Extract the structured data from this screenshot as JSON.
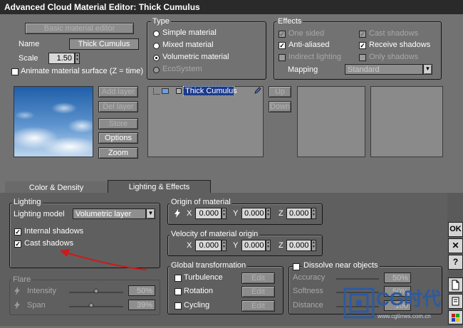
{
  "window": {
    "title": "Advanced Cloud Material Editor: Thick Cumulus"
  },
  "material": {
    "basic_editor_label": "Basic material editor",
    "name_label": "Name",
    "name_value": "Thick Cumulus",
    "scale_label": "Scale",
    "scale_value": "1.50",
    "animate_label": "Animate material surface (Z = time)",
    "animate_checked": false
  },
  "type_group": {
    "title": "Type",
    "options": [
      {
        "label": "Simple material",
        "selected": false,
        "enabled": true
      },
      {
        "label": "Mixed material",
        "selected": false,
        "enabled": true
      },
      {
        "label": "Volumetric material",
        "selected": true,
        "enabled": true
      },
      {
        "label": "EcoSystem",
        "selected": false,
        "enabled": false
      }
    ]
  },
  "effects_group": {
    "title": "Effects",
    "one_sided": {
      "label": "One sided",
      "checked": true,
      "enabled": false
    },
    "cast_shadows": {
      "label": "Cast shadows",
      "checked": true,
      "enabled": false
    },
    "anti_aliased": {
      "label": "Anti-aliased",
      "checked": true,
      "enabled": true
    },
    "receive_shadows": {
      "label": "Receive shadows",
      "checked": true,
      "enabled": true
    },
    "indirect_lighting": {
      "label": "Indirect lighting",
      "checked": false,
      "enabled": false
    },
    "only_shadows": {
      "label": "Only shadows",
      "checked": false,
      "enabled": false
    },
    "mapping_label": "Mapping",
    "mapping_value": "Standard"
  },
  "layers": {
    "add_label": "Add layer",
    "del_label": "Del layer",
    "store_label": "Store",
    "options_label": "Options",
    "zoom_label": "Zoom",
    "list": [
      {
        "name": "Thick Cumulus"
      }
    ],
    "up_label": "Up",
    "down_label": "Down"
  },
  "tabs": [
    {
      "label": "Color & Density",
      "active": false
    },
    {
      "label": "Lighting & Effects",
      "active": true
    }
  ],
  "lighting": {
    "title": "Lighting",
    "model_label": "Lighting model",
    "model_value": "Volumetric layer",
    "internal_shadows_label": "Internal shadows",
    "internal_shadows_checked": true,
    "cast_shadows_label": "Cast shadows",
    "cast_shadows_checked": true
  },
  "flare": {
    "title": "Flare",
    "intensity_label": "Intensity",
    "intensity_value": "50%",
    "intensity_level": 0.5,
    "span_label": "Span",
    "span_value": "39%",
    "span_level": 0.39
  },
  "origin": {
    "title": "Origin of material",
    "x_label": "X",
    "x_value": "0.000",
    "y_label": "Y",
    "y_value": "0.000",
    "z_label": "Z",
    "z_value": "0.000"
  },
  "velocity": {
    "title": "Velocity of material origin",
    "x_label": "X",
    "x_value": "0.000",
    "y_label": "Y",
    "y_value": "0.000",
    "z_label": "Z",
    "z_value": "0.000"
  },
  "global_transform": {
    "title": "Global transformation",
    "items": [
      {
        "label": "Turbulence",
        "edit_label": "Edit",
        "checked": false
      },
      {
        "label": "Rotation",
        "edit_label": "Edit",
        "checked": false
      },
      {
        "label": "Cycling",
        "edit_label": "Edit",
        "checked": false
      }
    ]
  },
  "dissolve": {
    "label": "Dissolve near objects",
    "checked": false,
    "accuracy_label": "Accuracy",
    "accuracy_value": "50%",
    "accuracy_level": 0.5,
    "softness_label": "Softness",
    "softness_value": "50%",
    "softness_level": 0.5,
    "distance_label": "Distance",
    "distance_value": "100",
    "distance_level": 0.3
  },
  "side_buttons": {
    "ok_label": "OK",
    "cancel_label": "✕",
    "help_label": "?"
  },
  "watermark": {
    "text": "CG时代",
    "url": "www.cgtimes.com.cn"
  },
  "colors": {
    "annotation_arrow": "#cc1a1a",
    "selection": "#1a3a8a",
    "watermark": "#2c5aa0"
  }
}
